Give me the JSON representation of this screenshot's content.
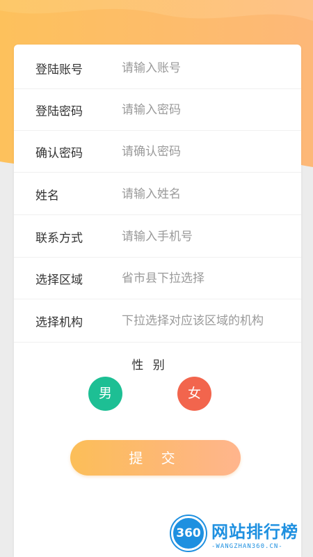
{
  "colors": {
    "accent_orange": "#fdb95c",
    "male": "#1dbf94",
    "female": "#f2654d",
    "watermark_blue": "#1e90e0"
  },
  "form": {
    "fields": [
      {
        "label": "登陆账号",
        "placeholder": "请输入账号"
      },
      {
        "label": "登陆密码",
        "placeholder": "请输入密码"
      },
      {
        "label": "确认密码",
        "placeholder": "请确认密码"
      },
      {
        "label": "姓名",
        "placeholder": "请输入姓名"
      },
      {
        "label": "联系方式",
        "placeholder": "请输入手机号"
      },
      {
        "label": "选择区域",
        "placeholder": "省市县下拉选择"
      },
      {
        "label": "选择机构",
        "placeholder": "下拉选择对应该区域的机构"
      }
    ],
    "gender": {
      "title": "性 别",
      "male": "男",
      "female": "女"
    },
    "submit": "提 交"
  },
  "watermark": {
    "badge": "360",
    "title": "网站排行榜",
    "subtitle": "-WANGZHAN360.CN-"
  }
}
